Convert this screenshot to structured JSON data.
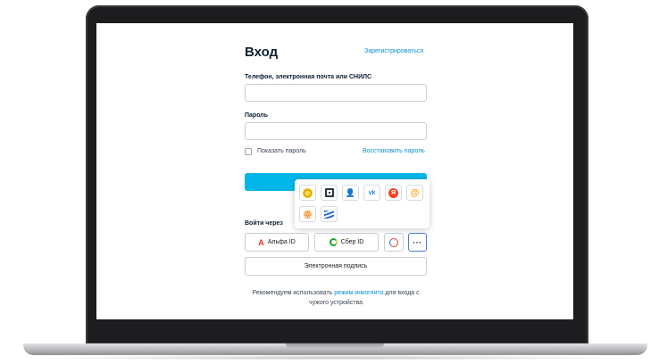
{
  "login": {
    "title": "Вход",
    "register_link": "Зарегистрироваться",
    "login_field_label": "Телефон, электронная почта или СНИЛС",
    "login_field_value": "",
    "password_field_label": "Пароль",
    "password_field_value": "",
    "show_password_label": "Показать пароль",
    "restore_password_link": "Восстановить пароль",
    "login_via_label": "Войти через",
    "alfa_id_label": "Альфа ID",
    "sber_id_label": "Сбер ID",
    "more_button_label": "···",
    "esignature_button_label": "Электронная подпись",
    "recommend_prefix": "Рекомендуем использовать ",
    "recommend_link": "режим инкогнито",
    "recommend_suffix": " для входа с чужого устройства"
  },
  "provider_popup": {
    "icons": [
      "gold-emblem-icon",
      "qr-scan-icon",
      "person-card-icon",
      "vk-icon",
      "yandex-icon",
      "mail-ru-icon",
      "odnoklassniki-icon",
      "stripes-logo-icon"
    ],
    "glyphs": {
      "person": "👤",
      "vk": "vk",
      "yandex": "Я",
      "mail": "@",
      "ok": "ꙮ"
    }
  },
  "glyphs": {
    "alfa": "А"
  },
  "colors": {
    "accent": "#00b6e8",
    "link": "#0d8fd6",
    "focus_border": "#4a7bd6"
  }
}
